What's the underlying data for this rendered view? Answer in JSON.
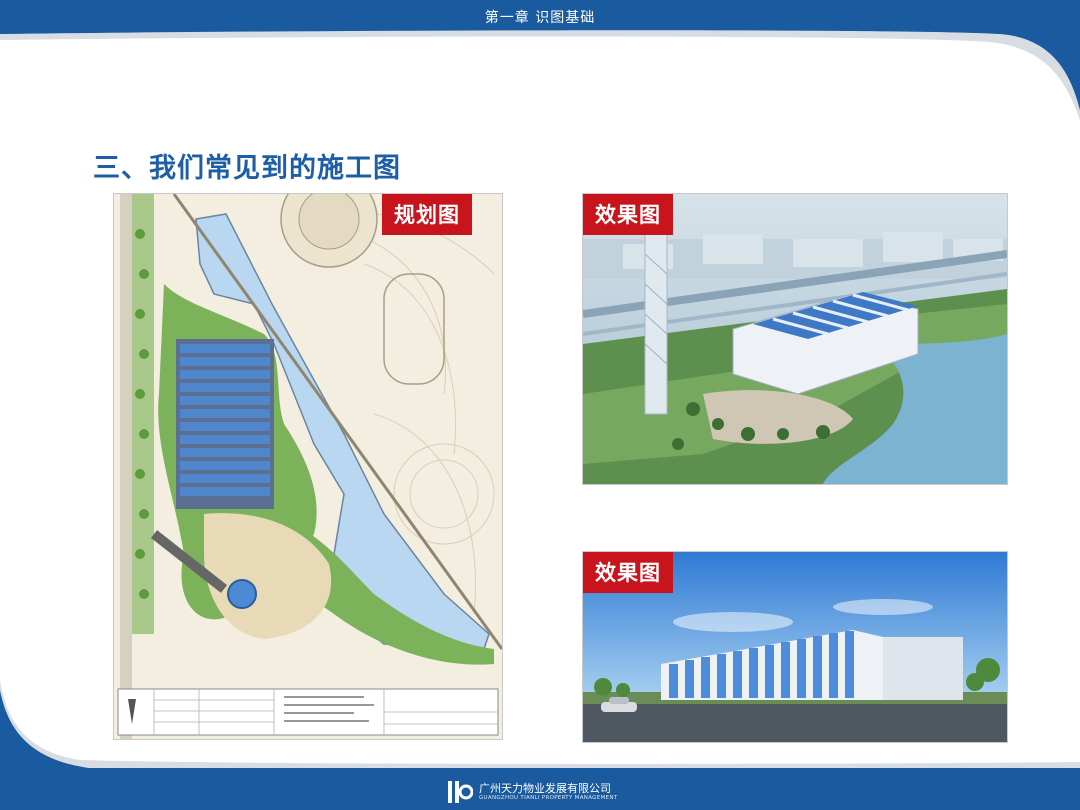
{
  "header": {
    "title": "第一章 识图基础"
  },
  "heading": "三、我们常见到的施工图",
  "panels": {
    "plan": {
      "tag": "规划图"
    },
    "effect_top": {
      "tag": "效果图"
    },
    "effect_bottom": {
      "tag": "效果图"
    }
  },
  "footer": {
    "company_cn": "广州天力物业发展有限公司",
    "company_en": "GUANGZHOU TIANLI PROPERTY MANAGEMENT"
  },
  "colors": {
    "frame_blue": "#1a5a9e",
    "heading_blue": "#1d5fa6",
    "tag_red": "#c8141c"
  }
}
